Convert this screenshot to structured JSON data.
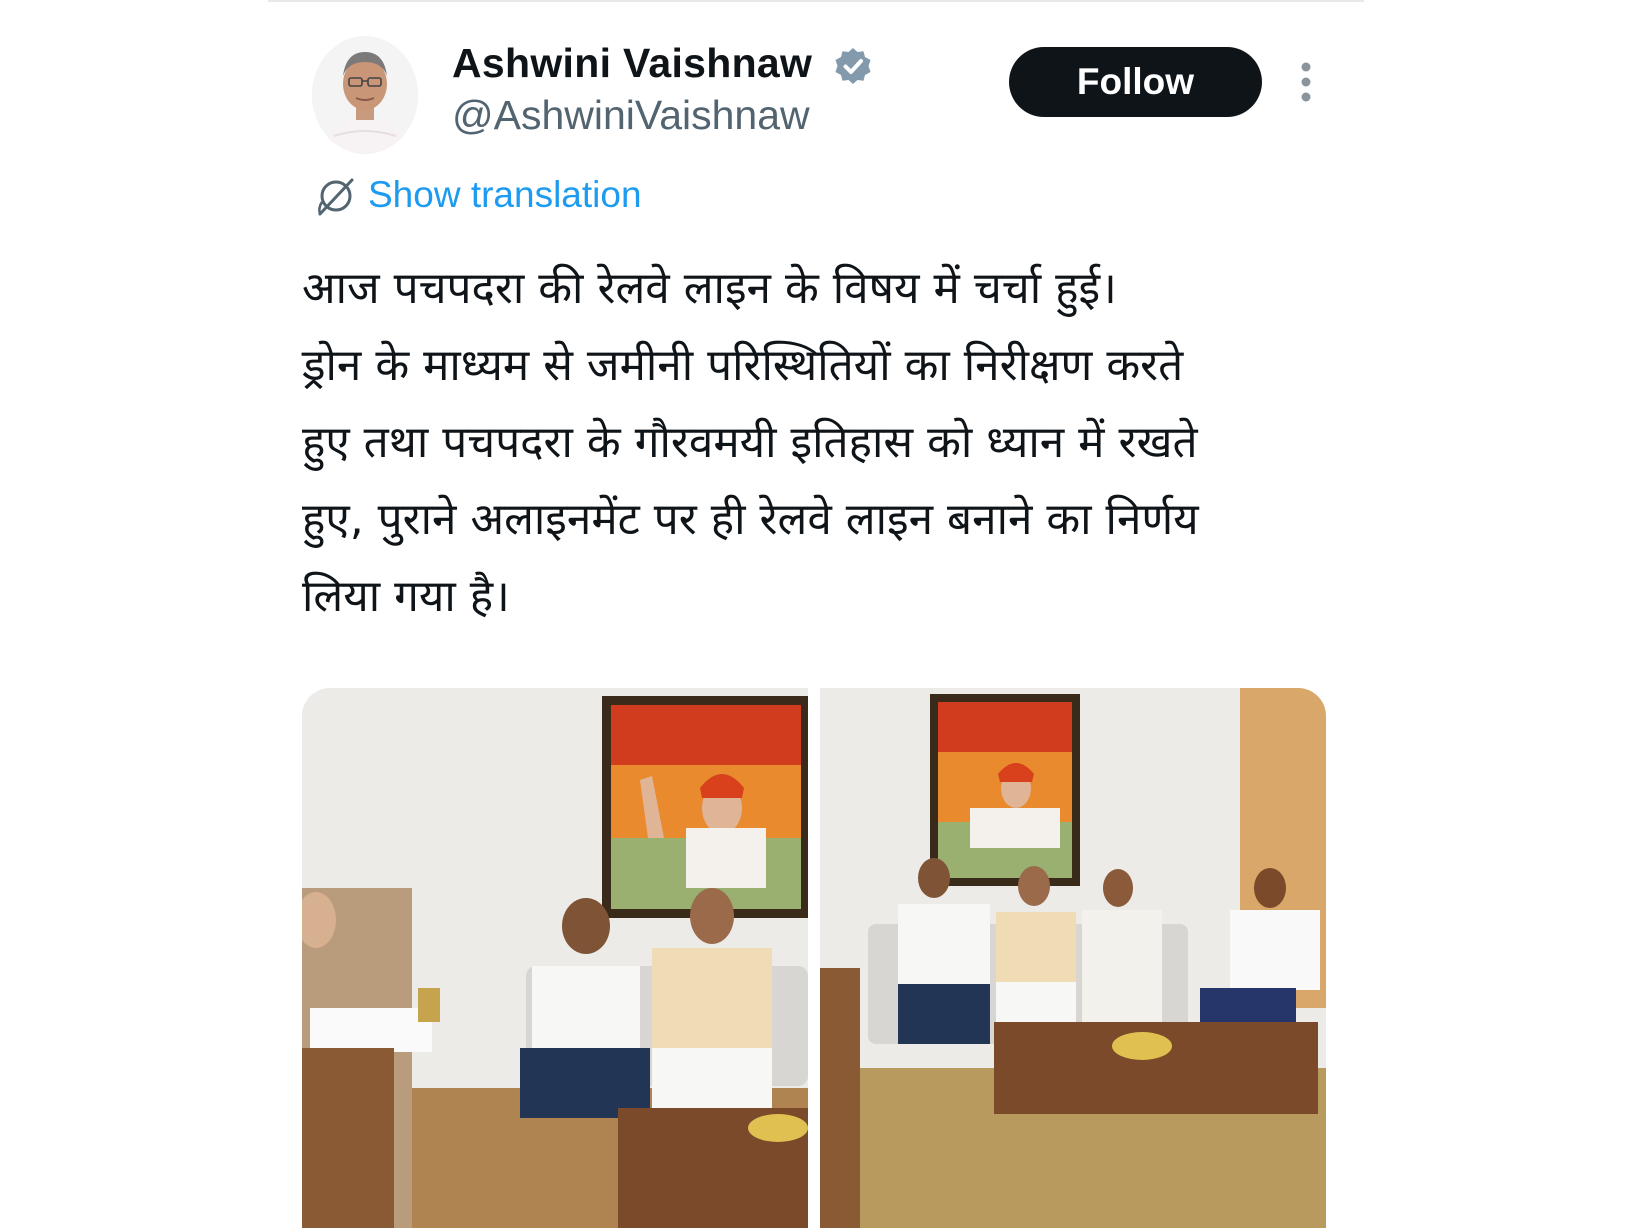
{
  "author": {
    "display_name": "Ashwini Vaishnaw",
    "handle": "@AshwiniVaishnaw",
    "verified": true,
    "avatar_icon": "profile-photo"
  },
  "actions": {
    "follow_label": "Follow",
    "more_icon": "more-vertical-icon"
  },
  "translation": {
    "label": "Show translation",
    "icon": "translate-globe-icon"
  },
  "tweet": {
    "text": "आज पचपदरा की रेलवे लाइन के विषय में चर्चा हुई।\nड्रोन के माध्यम से जमीनी परिस्थितियों का निरीक्षण करते\nहुए तथा पचपदरा के गौरवमयी इतिहास को ध्यान में रखते\nहुए, पुराने अलाइनमेंट पर ही रेलवे लाइन बनाने का निर्णय\nलिया गया है।"
  },
  "media": {
    "photos": [
      {
        "description_icon": "meeting-photo-1"
      },
      {
        "description_icon": "meeting-photo-2"
      }
    ]
  },
  "colors": {
    "text": "#0f1419",
    "secondary": "#536471",
    "link": "#1d9bf0",
    "verified_badge": "#829aab",
    "button_bg": "#0f1419"
  }
}
